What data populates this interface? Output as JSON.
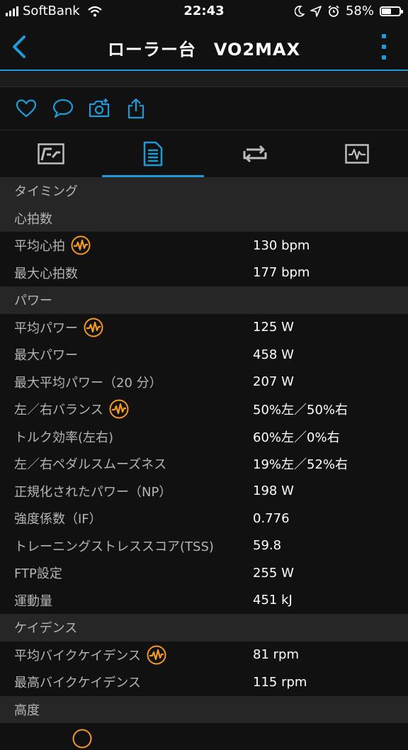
{
  "status_bar": {
    "carrier": "SoftBank",
    "time": "22:43",
    "battery_percent": "58%",
    "battery_level": 0.58
  },
  "nav": {
    "title": "ローラー台　VO2MAX"
  },
  "colors": {
    "accent": "#1e9bd7",
    "badge": "#f29a23",
    "header_bg": "#262626",
    "row_bg": "#111111"
  },
  "action_icons": [
    "heart-icon",
    "comment-icon",
    "camera-add-icon",
    "share-icon"
  ],
  "tabs": [
    "summary-chart-icon",
    "details-list-icon",
    "laps-icon",
    "graph-icon"
  ],
  "active_tab": 1,
  "list": {
    "timing": "タイミング",
    "heart_rate": {
      "header": "心拍数",
      "avg_label": "平均心拍",
      "avg_value": "130 bpm",
      "max_label": "最大心拍数",
      "max_value": "177 bpm"
    },
    "power": {
      "header": "パワー",
      "avg_label": "平均パワー",
      "avg_value": "125 W",
      "max_label": "最大パワー",
      "max_value": "458 W",
      "max20_label": "最大平均パワー（20 分）",
      "max20_value": "207 W",
      "balance_label": "左／右バランス",
      "balance_value": "50%左／50%右",
      "torque_label": "トルク効率(左右)",
      "torque_value": "60%左／0%右",
      "smooth_label": "左／右ペダルスムーズネス",
      "smooth_value": "19%左／52%右",
      "np_label": "正規化されたパワー（NP）",
      "np_value": "198 W",
      "if_label": "強度係数（IF）",
      "if_value": "0.776",
      "tss_label": "トレーニングストレススコア(TSS)",
      "tss_value": "59.8",
      "ftp_label": "FTP設定",
      "ftp_value": "255 W",
      "work_label": "運動量",
      "work_value": "451 kJ"
    },
    "cadence": {
      "header": "ケイデンス",
      "avg_label": "平均バイクケイデンス",
      "avg_value": "81 rpm",
      "max_label": "最高バイクケイデンス",
      "max_value": "115 rpm"
    },
    "altitude": {
      "header": "高度"
    }
  }
}
